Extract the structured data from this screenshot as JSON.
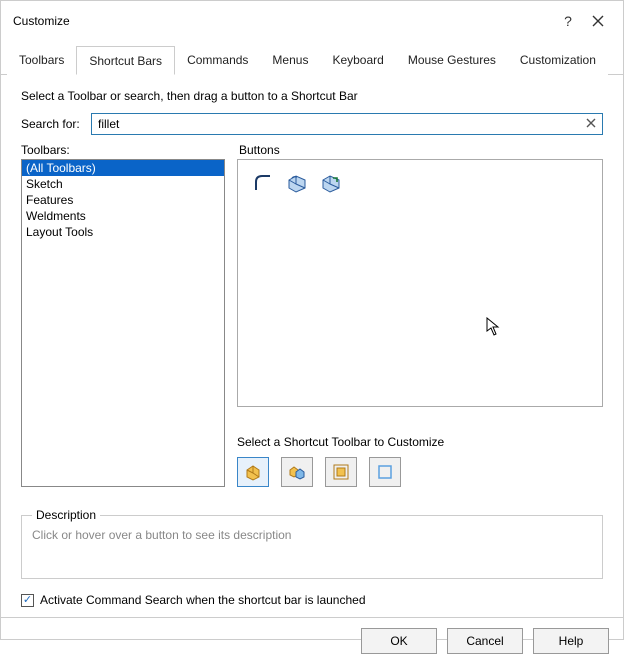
{
  "window": {
    "title": "Customize"
  },
  "tabs": [
    "Toolbars",
    "Shortcut Bars",
    "Commands",
    "Menus",
    "Keyboard",
    "Mouse Gestures",
    "Customization"
  ],
  "selected_tab_index": 1,
  "instruction": "Select a Toolbar or search, then drag a button to a Shortcut Bar",
  "search": {
    "label": "Search for:",
    "value": "fillet"
  },
  "toolbars": {
    "label": "Toolbars:",
    "items": [
      "(All Toolbars)",
      "Sketch",
      "Features",
      "Weldments",
      "Layout Tools"
    ],
    "selected_index": 0
  },
  "buttons": {
    "label": "Buttons"
  },
  "shortcut": {
    "label": "Select a Shortcut Toolbar to Customize"
  },
  "description": {
    "label": "Description",
    "placeholder": "Click or hover over a button to see its description"
  },
  "checkbox": {
    "label": "Activate Command Search when the shortcut bar is launched",
    "checked": true
  },
  "footer": {
    "ok": "OK",
    "cancel": "Cancel",
    "help": "Help"
  }
}
